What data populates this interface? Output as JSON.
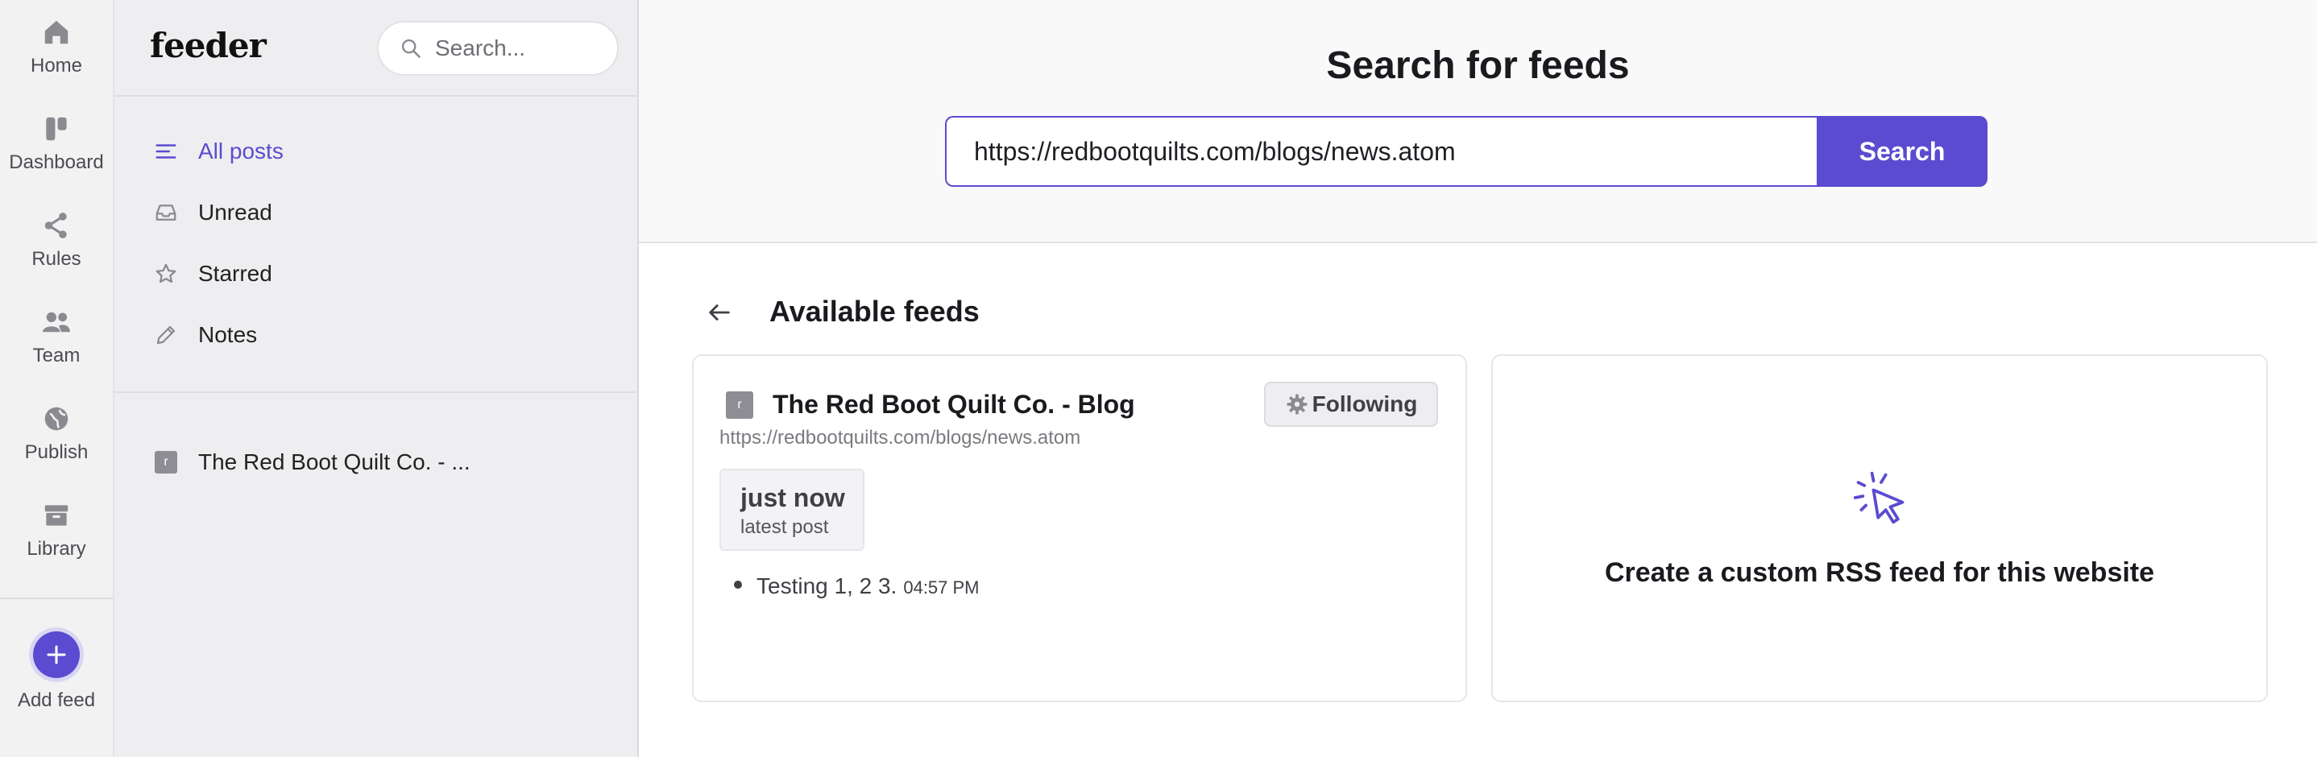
{
  "rail": {
    "items": [
      {
        "label": "Home",
        "icon": "home-icon"
      },
      {
        "label": "Dashboard",
        "icon": "dashboard-icon"
      },
      {
        "label": "Rules",
        "icon": "share-icon"
      },
      {
        "label": "Team",
        "icon": "team-icon"
      },
      {
        "label": "Publish",
        "icon": "globe-icon"
      },
      {
        "label": "Library",
        "icon": "archive-icon"
      }
    ],
    "add_feed_label": "Add feed"
  },
  "sidebar": {
    "logo": "feeder",
    "search_placeholder": "Search...",
    "nav": [
      {
        "label": "All posts",
        "icon": "list-icon",
        "active": true
      },
      {
        "label": "Unread",
        "icon": "inbox-icon"
      },
      {
        "label": "Starred",
        "icon": "star-icon"
      },
      {
        "label": "Notes",
        "icon": "pencil-icon"
      }
    ],
    "feeds": [
      {
        "label": "The Red Boot Quilt Co. - ...",
        "initial": "r"
      }
    ]
  },
  "main": {
    "title": "Search for feeds",
    "search_value": "https://redbootquilts.com/blogs/news.atom",
    "search_button": "Search",
    "available_title": "Available feeds",
    "feed_card": {
      "initial": "r",
      "name": "The Red Boot Quilt Co. - Blog",
      "url": "https://redbootquilts.com/blogs/news.atom",
      "follow_label": "Following",
      "stat_big": "just now",
      "stat_small": "latest post",
      "posts": [
        {
          "title": "Testing 1, 2 3.",
          "time": "04:57 PM"
        }
      ]
    },
    "custom_card": {
      "text": "Create a custom RSS feed for this website"
    }
  },
  "colors": {
    "accent": "#5b4bd1",
    "rail_bg": "#f2f2f3",
    "sidebar_bg": "#eeeef0",
    "main_top_bg": "#f9f9f9"
  }
}
